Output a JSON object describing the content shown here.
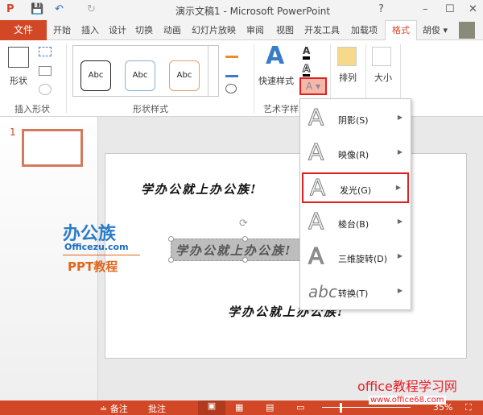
{
  "window": {
    "title": "演示文稿1 - Microsoft PowerPoint",
    "help": "?",
    "min": "–",
    "max": "☐",
    "close": "✕"
  },
  "quick_access": {
    "app": "P",
    "save": "💾",
    "undo": "↶",
    "redo": "↻"
  },
  "tabs": {
    "file": "文件",
    "items": [
      "开始",
      "插入",
      "设计",
      "切换",
      "动画",
      "幻灯片放映",
      "审阅",
      "视图",
      "开发工具",
      "加载项"
    ],
    "active": "格式",
    "user": "胡俊 ▾"
  },
  "ribbon": {
    "shape": "形状",
    "group_insert": "插入形状",
    "abc": [
      "Abc",
      "Abc",
      "Abc"
    ],
    "group_style": "形状样式",
    "quick_style": "快速样式",
    "group_art": "艺术字样式",
    "arrange": "排列",
    "size": "大小"
  },
  "menu": {
    "items": [
      {
        "label": "阴影(S)",
        "icon": "A"
      },
      {
        "label": "映像(R)",
        "icon": "A"
      },
      {
        "label": "发光(G)",
        "icon": "A"
      },
      {
        "label": "棱台(B)",
        "icon": "A"
      },
      {
        "label": "三维旋转(D)",
        "icon": "A"
      },
      {
        "label": "转换(T)",
        "icon": "abc"
      }
    ],
    "highlighted": "发光(G)"
  },
  "slides_panel": {
    "number": "1"
  },
  "slide": {
    "line1": "学办公就上办公族!",
    "line2": "学办公就上办公族!",
    "line3": "学办公就上办公族!"
  },
  "logo": {
    "name": "办公族",
    "url": "Officezu.com",
    "sub": "PPT教程"
  },
  "watermark": {
    "text": "office教程学习网",
    "url": "www.office68.com"
  },
  "status": {
    "notes": "≐ 备注",
    "comments": "批注",
    "zoom": "35%"
  },
  "colors": {
    "accent": "#d24726",
    "highlight": "#e02020"
  }
}
